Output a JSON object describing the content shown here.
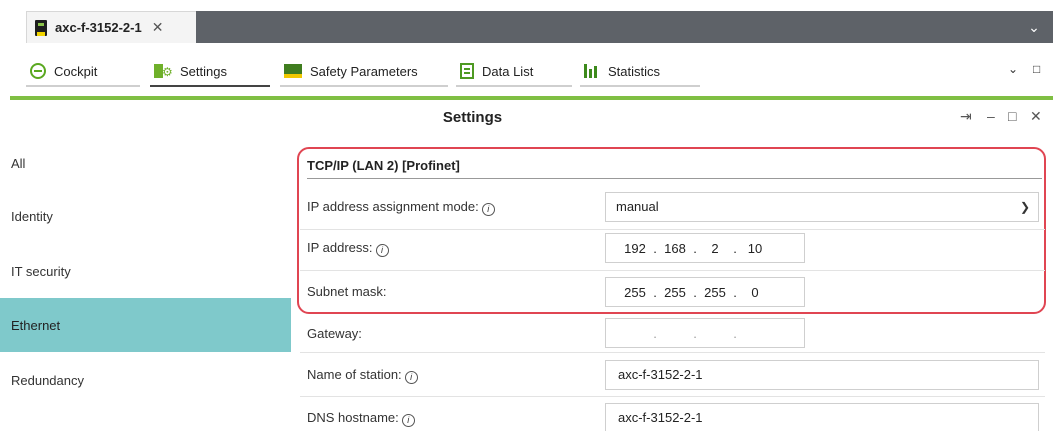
{
  "document_tab": {
    "label": "axc-f-3152-2-1",
    "close": "✕"
  },
  "top_expand": "⌄",
  "toolbar": {
    "tabs": [
      {
        "label": "Cockpit",
        "icon": "cockpit-icon"
      },
      {
        "label": "Settings",
        "icon": "settings-icon"
      },
      {
        "label": "Safety Parameters",
        "icon": "safety-icon"
      },
      {
        "label": "Data List",
        "icon": "data-list-icon"
      },
      {
        "label": "Statistics",
        "icon": "statistics-icon"
      }
    ],
    "active_tab": "Settings",
    "overflow": "⌄",
    "maximize": "□"
  },
  "panel": {
    "title": "Settings",
    "pin": "⇥",
    "minimize": "–",
    "maximize": "□",
    "close": "✕"
  },
  "sidebar": {
    "items": [
      {
        "label": "All"
      },
      {
        "label": "Identity"
      },
      {
        "label": "IT security"
      },
      {
        "label": "Ethernet"
      },
      {
        "label": "Redundancy"
      }
    ],
    "active": "Ethernet"
  },
  "section": {
    "title": "TCP/IP (LAN 2) [Profinet]",
    "ip_mode": {
      "label": "IP address assignment mode:",
      "value": "manual"
    },
    "ip_address": {
      "label": "IP address:",
      "octets": [
        "192",
        "168",
        "2",
        "10"
      ]
    },
    "subnet_mask": {
      "label": "Subnet mask:",
      "octets": [
        "255",
        "255",
        "255",
        "0"
      ]
    }
  },
  "gateway": {
    "label": "Gateway:",
    "octets": [
      "",
      "",
      "",
      ""
    ]
  },
  "station_name": {
    "label": "Name of station:",
    "value": "axc-f-3152-2-1"
  },
  "dns_hostname": {
    "label": "DNS hostname:",
    "value": "axc-f-3152-2-1"
  },
  "colors": {
    "accent_green": "#7fbf43",
    "active_sidebar": "#7fc9cb",
    "highlight_border": "#e04552",
    "topbar_dark": "#5e6268"
  }
}
